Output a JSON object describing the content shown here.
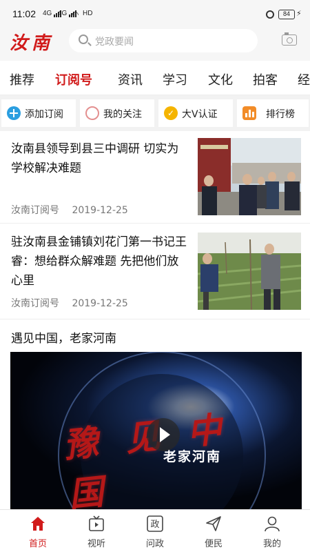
{
  "status_bar": {
    "time": "11:02",
    "sig1": "4G",
    "sig2": "4G",
    "hd": "HD",
    "battery": "84"
  },
  "header": {
    "logo": "汝南",
    "search_placeholder": "党政要闻"
  },
  "tabs": [
    {
      "label": "推荐",
      "active": false
    },
    {
      "label": "订阅号",
      "active": true
    },
    {
      "label": "资讯",
      "active": false
    },
    {
      "label": "学习",
      "active": false
    },
    {
      "label": "文化",
      "active": false
    },
    {
      "label": "拍客",
      "active": false
    },
    {
      "label": "经",
      "active": false
    }
  ],
  "quick_actions": [
    {
      "label": "添加订阅",
      "icon": "plus-circle-icon"
    },
    {
      "label": "我的关注",
      "icon": "ring-icon"
    },
    {
      "label": "大V认证",
      "icon": "v-badge-icon"
    },
    {
      "label": "排行榜",
      "icon": "bar-chart-icon"
    }
  ],
  "news": [
    {
      "title": "汝南县领导到县三中调研 切实为学校解决难题",
      "source": "汝南订阅号",
      "date": "2019-12-25"
    },
    {
      "title": "驻汝南县金铺镇刘花门第一书记王睿：想给群众解难题 先把他们放心里",
      "source": "汝南订阅号",
      "date": "2019-12-25"
    }
  ],
  "section": {
    "title": "遇见中国，老家河南",
    "video_title_art": "豫见中国",
    "video_subtitle": "老家河南"
  },
  "bottom_nav": [
    {
      "label": "首页",
      "icon": "home-icon",
      "active": true
    },
    {
      "label": "视听",
      "icon": "tv-icon",
      "active": false
    },
    {
      "label": "问政",
      "icon": "zheng-icon",
      "active": false
    },
    {
      "label": "便民",
      "icon": "send-icon",
      "active": false
    },
    {
      "label": "我的",
      "icon": "user-icon",
      "active": false
    }
  ],
  "colors": {
    "accent": "#d11b1b",
    "divider": "#f2f2f2"
  }
}
